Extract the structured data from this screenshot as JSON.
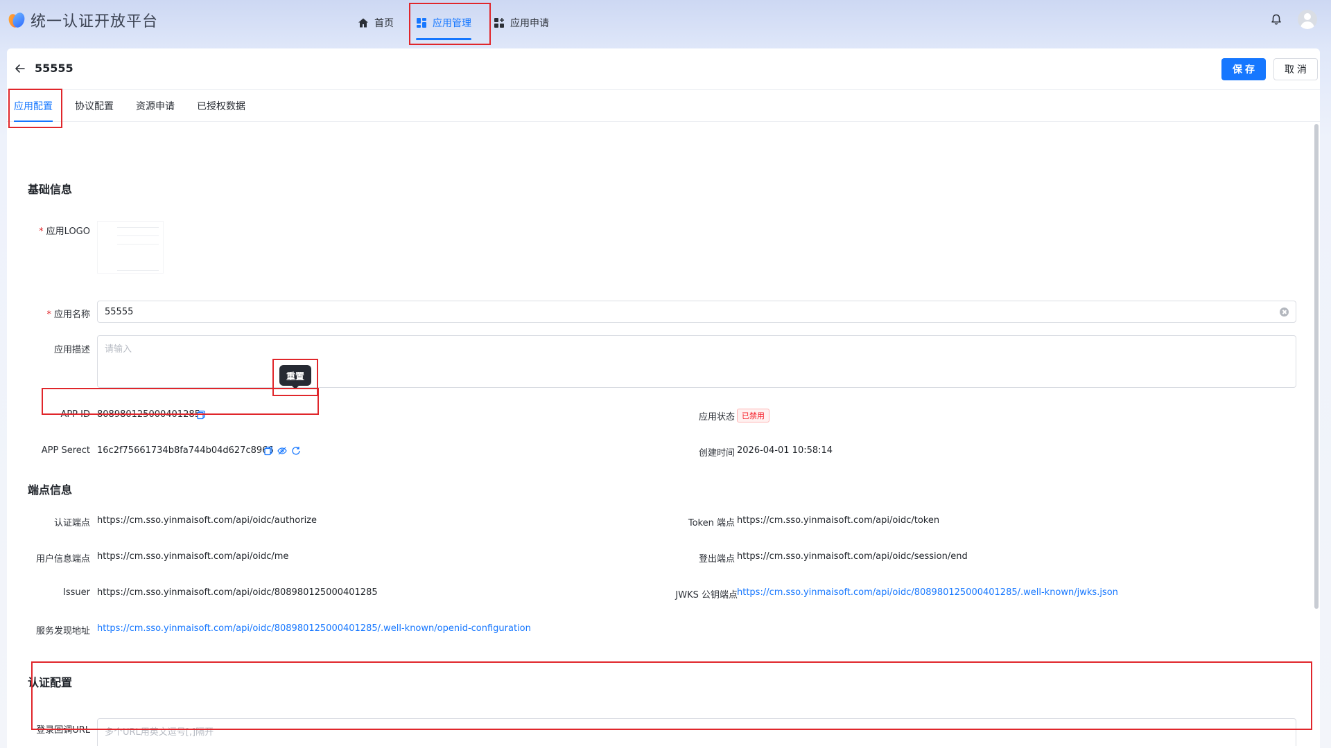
{
  "app": {
    "title": "统一认证开放平台"
  },
  "nav": {
    "items": [
      {
        "label": "首页",
        "icon": "home-icon"
      },
      {
        "label": "应用管理",
        "icon": "grid-icon",
        "active": true
      },
      {
        "label": "应用申请",
        "icon": "apps-add-icon"
      }
    ]
  },
  "header": {
    "title": "55555",
    "save_label": "保存",
    "cancel_label": "取消"
  },
  "tabs": [
    {
      "label": "应用配置",
      "active": true
    },
    {
      "label": "协议配置"
    },
    {
      "label": "资源申请"
    },
    {
      "label": "已授权数据"
    }
  ],
  "basic": {
    "section_title": "基础信息",
    "logo_label": "应用LOGO",
    "name_label": "应用名称",
    "name_value": "55555",
    "desc_label": "应用描述",
    "desc_placeholder": "请输入",
    "appid_label": "APP ID",
    "appid_value": "808980125000401285",
    "secret_label": "APP Serect",
    "secret_value": "16c2f75661734b8fa744b04d627c8966",
    "reset_tooltip": "重置",
    "status_label": "应用状态",
    "status_value": "已禁用",
    "created_label": "创建时间",
    "created_value": "2026-04-01 10:58:14"
  },
  "endpoints": {
    "section_title": "端点信息",
    "auth_label": "认证端点",
    "auth_value": "https://cm.sso.yinmaisoft.com/api/oidc/authorize",
    "token_label": "Token 端点",
    "token_value": "https://cm.sso.yinmaisoft.com/api/oidc/token",
    "userinfo_label": "用户信息端点",
    "userinfo_value": "https://cm.sso.yinmaisoft.com/api/oidc/me",
    "logout_label": "登出端点",
    "logout_value": "https://cm.sso.yinmaisoft.com/api/oidc/session/end",
    "issuer_label": "Issuer",
    "issuer_value": "https://cm.sso.yinmaisoft.com/api/oidc/808980125000401285",
    "jwks_label": "JWKS 公钥端点",
    "jwks_value": "https://cm.sso.yinmaisoft.com/api/oidc/808980125000401285/.well-known/jwks.json",
    "discovery_label": "服务发现地址",
    "discovery_value": "https://cm.sso.yinmaisoft.com/api/oidc/808980125000401285/.well-known/openid-configuration"
  },
  "auth": {
    "section_title": "认证配置",
    "callback_label": "登录回调URL",
    "callback_placeholder": "多个URL用英文逗号[,]隔开"
  },
  "colors": {
    "primary": "#1677ff",
    "danger": "#f5222d",
    "highlight_box": "#e0262b"
  }
}
